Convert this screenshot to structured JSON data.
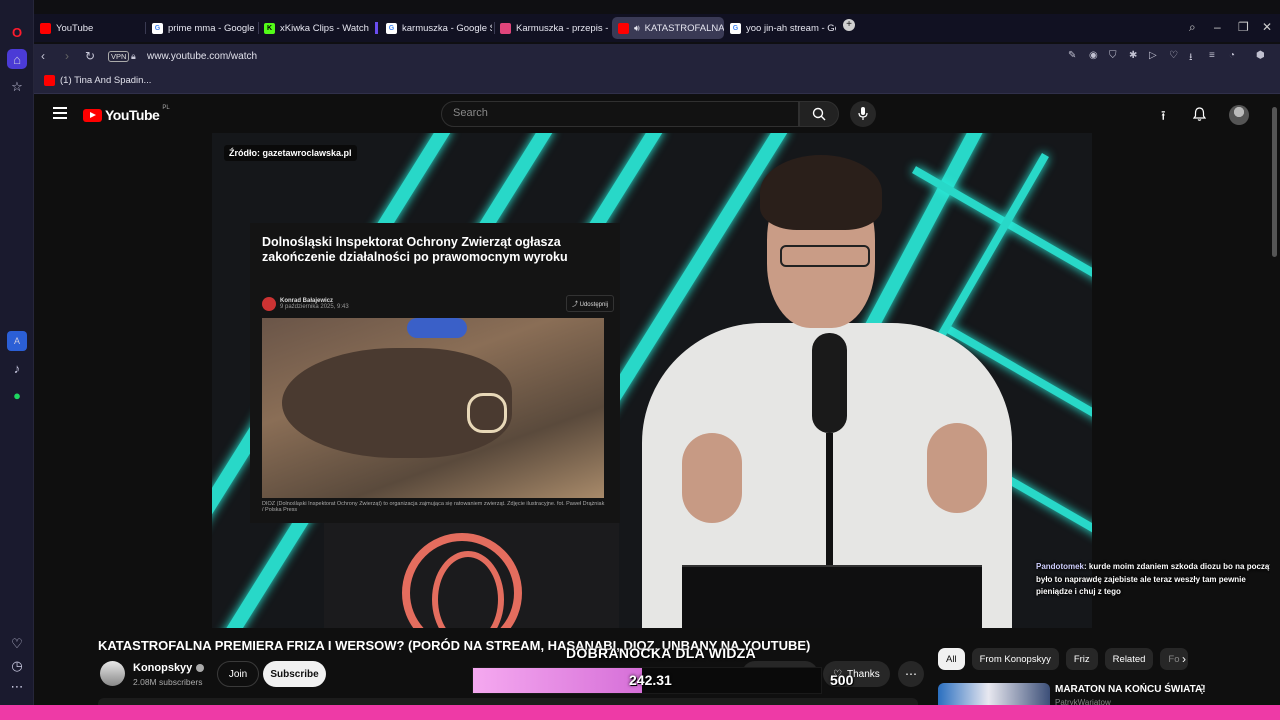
{
  "browser": {
    "tabs": [
      {
        "label": "YouTube",
        "fav_color": "#ff0000"
      },
      {
        "label": "prime mma - Google Sear",
        "fav_color": "#4285f4"
      },
      {
        "label": "xKiwka Clips - Watch Live",
        "fav_color": "#53fc18"
      },
      {
        "label": "karmuszka - Google Sear",
        "fav_color": "#4285f4"
      },
      {
        "label": "Karmuszka - przepis - Mo",
        "fav_color": "#e0457b"
      },
      {
        "label": "KATASTROFALNA PREI",
        "fav_color": "#ff0000"
      },
      {
        "label": "yoo jin-ah stream - Googl",
        "fav_color": "#4285f4"
      }
    ],
    "new_tab_icon": "+",
    "vpn_label": "VPN",
    "url": "www.youtube.com/watch",
    "bookmark": "(1) Tina And Spadin..."
  },
  "youtube": {
    "logo_text": "YouTube",
    "country_code": "PL",
    "search_placeholder": "Search",
    "video": {
      "source_tag": "Źródło: gazetawroclawska.pl",
      "article_title": "Dolnośląski Inspektorat Ochrony Zwierząt ogłasza zakończenie działalności po prawomocnym wyroku",
      "article_author": "Konrad Bałajewicz",
      "article_date": "9 października 2025, 9:43",
      "article_share": "Udostępnij",
      "article_caption": "DIOZ (Dolnośląski Inspektorat Ochrony Zwierząt) to organizacja zajmująca się ratowaniem zwierząt. Zdjęcie ilustracyjne. fot. Paweł Drążniak / Polska Press",
      "chat_user": "Pandotomek",
      "chat_message": ": kurde moim zdaniem szkoda diozu bo na początku było to naprawdę zajebiste ale teraz weszły tam pewnie pieniądze i chuj z tego"
    },
    "title": "KATASTROFALNA PREMIERA FRIZA I WERSOW? (PORÓD NA STREAM, HASANABI, DIOZ, UNBANY NA YOUTUBE)",
    "channel": {
      "name": "Konopskyy",
      "subscribers": "2.08M subscribers",
      "join": "Join",
      "subscribe": "Subscribe"
    },
    "actions": {
      "thanks": "Thanks"
    },
    "goal": {
      "title": "DOBRANOCKA DLA WIDZA",
      "value": "242.31",
      "target": "500",
      "progress": 0.4846
    },
    "chips": [
      "All",
      "From Konopskyy",
      "Friz",
      "Related",
      "Fo"
    ],
    "recommendation": {
      "title": "MARATON NA KOŃCU ŚWIATA!",
      "channel": "PatrykWariatow"
    }
  }
}
